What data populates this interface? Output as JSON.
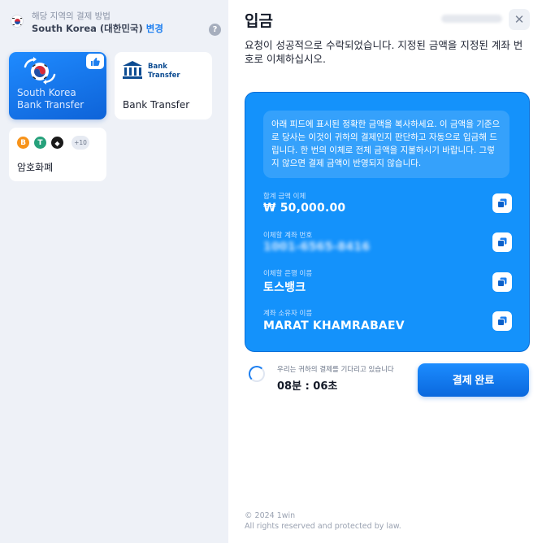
{
  "region": {
    "caption": "해당 지역의 결제 방법",
    "country": "South Korea (대한민국)",
    "change_label": "변경",
    "help_label": "?"
  },
  "methods": [
    {
      "label_line1": "South Korea",
      "label_line2": "Bank Transfer",
      "selected": true
    },
    {
      "logo_line1": "Bank",
      "logo_line2": "Transfer",
      "label": "Bank Transfer"
    },
    {
      "label": "암호화폐",
      "coins": [
        {
          "symbol": "B",
          "color": "#f7931a"
        },
        {
          "symbol": "T",
          "color": "#26a17b"
        },
        {
          "symbol": "◆",
          "color": "#1a1a1a"
        }
      ],
      "more": "+10"
    }
  ],
  "deposit": {
    "title": "입금",
    "description": "요청이 성공적으로 수락되었습니다. 지정된 금액을 지정된 계좌 번호로 이체하십시오.",
    "notice": "아래 피드에 표시된 정확한 금액을 복사하세요. 이 금액을 기준으로 당사는 이것이 귀하의 결제인지 판단하고 자동으로 입금해 드립니다. 한 번의 이체로 전체 금액을 지불하시기 바랍니다. 그렇지 않으면 결제 금액이 반영되지 않습니다.",
    "fields": [
      {
        "label": "합계 금액 이체",
        "value": "₩ 50,000.00"
      },
      {
        "label": "이체할 계좌 번호",
        "value": "1001-6565-8416"
      },
      {
        "label": "이체할 은행 이름",
        "value": "토스뱅크"
      },
      {
        "label": "계좌 소유자 이름",
        "value": "MARAT KHAMRABAEV"
      }
    ],
    "waiting_text": "우리는 귀하의 결제를 기다리고 있습니다",
    "timer": "08분 : 06초",
    "complete_button": "결제 완료"
  },
  "footer": {
    "copyright": "© 2024 1win",
    "rights": "All rights reserved and protected by law."
  },
  "colors": {
    "accent": "#1492fb",
    "sidebar_bg": "#eef1f7"
  }
}
